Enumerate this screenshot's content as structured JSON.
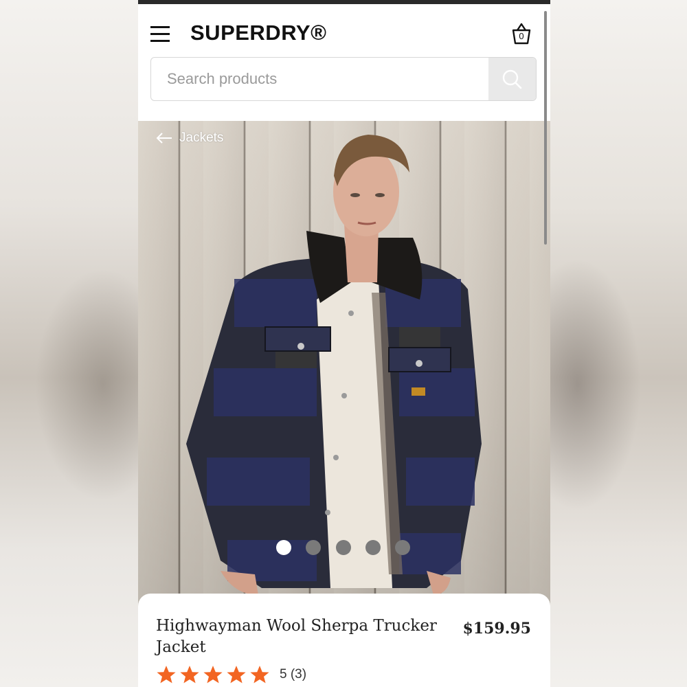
{
  "header": {
    "logo_text": "SUPERDRY®",
    "basket_count": "0",
    "menu_icon": "hamburger-menu-icon",
    "basket_icon": "basket-icon"
  },
  "search": {
    "placeholder": "Search products",
    "value": "",
    "button_icon": "search-icon"
  },
  "hero": {
    "breadcrumb_label": "Jackets",
    "back_icon": "arrow-left-icon",
    "carousel": {
      "total_slides": 5,
      "active_index": 0
    }
  },
  "product": {
    "title": "Highwayman Wool Sherpa Trucker Jacket",
    "price": "$159.95",
    "rating_value": 5,
    "rating_max": 5,
    "rating_text": "5 (3)"
  },
  "colors": {
    "star": "#f26522",
    "text": "#222222",
    "search_button_bg": "#e9e9e9",
    "dot_active": "#ffffff",
    "dot_inactive": "#7a7a7a"
  }
}
